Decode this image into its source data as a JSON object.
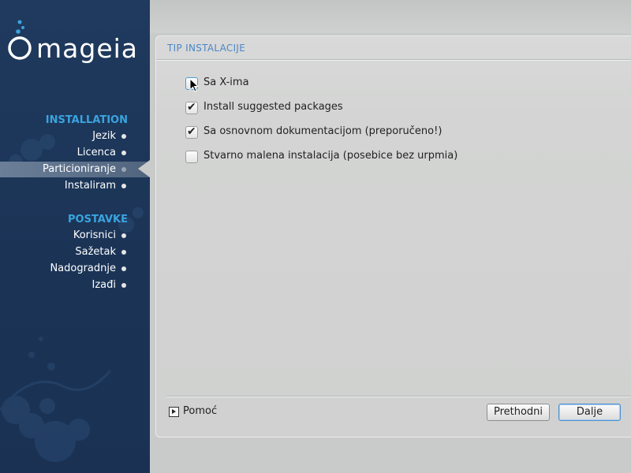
{
  "brand": {
    "logo_text": "mageia"
  },
  "sidebar": {
    "sections": [
      {
        "title": "INSTALLATION",
        "items": [
          {
            "label": "Jezik",
            "active": false
          },
          {
            "label": "Licenca",
            "active": false
          },
          {
            "label": "Particioniranje",
            "active": true
          },
          {
            "label": "Instaliram",
            "active": false
          }
        ]
      },
      {
        "title": "POSTAVKE",
        "items": [
          {
            "label": "Korisnici",
            "active": false
          },
          {
            "label": "Sažetak",
            "active": false
          },
          {
            "label": "Nadogradnje",
            "active": false
          },
          {
            "label": "Izađi",
            "active": false
          }
        ]
      }
    ]
  },
  "panel": {
    "title": "TIP INSTALACIJE",
    "options": [
      {
        "label": "Sa X-ima",
        "checked": false
      },
      {
        "label": "Install suggested packages",
        "checked": true
      },
      {
        "label": "Sa osnovnom dokumentacijom (preporučeno!)",
        "checked": true
      },
      {
        "label": "Stvarno malena instalacija (posebice bez urpmia)",
        "checked": false
      }
    ]
  },
  "footer": {
    "help_label": "Pomoć",
    "prev_label": "Prethodni",
    "next_label": "Dalje"
  },
  "colors": {
    "sidebar_bg": "#1c3558",
    "section_title": "#3aa4e0",
    "panel_title": "#4c86c7",
    "default_button_border": "#4a8fd0"
  },
  "icons": [
    "mageia-logo-icon",
    "checkmark-icon",
    "mouse-cursor-icon",
    "help-expand-icon",
    "nav-bullet-icon"
  ]
}
